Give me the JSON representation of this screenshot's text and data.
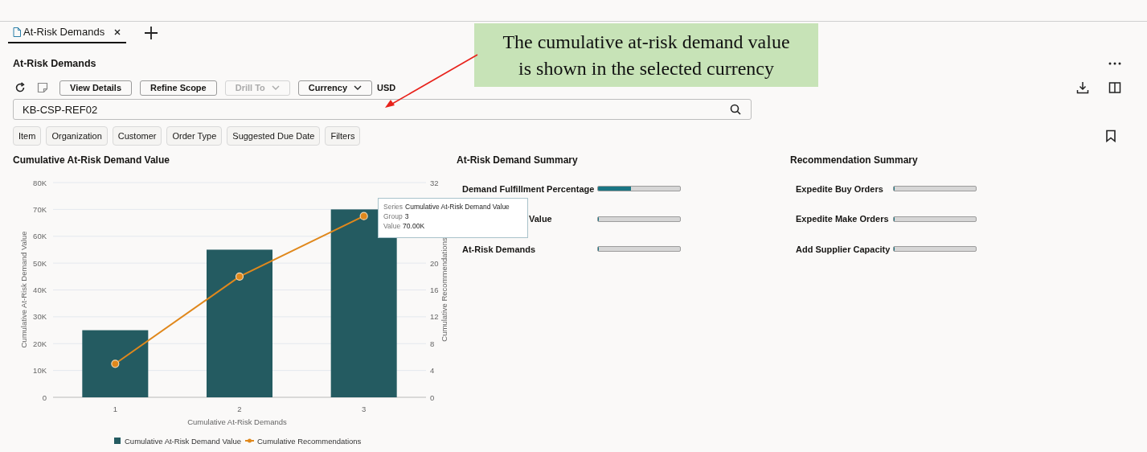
{
  "tab_bar": {
    "tabs": [
      {
        "label": "At-Risk Demands",
        "selected": true
      }
    ]
  },
  "page": {
    "title": "At-Risk Demands"
  },
  "toolbar": {
    "buttons": [
      {
        "label": "View Details",
        "kind": "button",
        "disabled": false
      },
      {
        "label": "Refine Scope",
        "kind": "button",
        "disabled": false
      },
      {
        "label": "Drill To",
        "kind": "menu",
        "disabled": true
      },
      {
        "label": "Currency",
        "kind": "menu",
        "disabled": false
      }
    ],
    "currency": "USD"
  },
  "search": {
    "value": "KB-CSP-REF02"
  },
  "filters": [
    "Item",
    "Organization",
    "Customer",
    "Order Type",
    "Suggested Due Date",
    "Filters"
  ],
  "chart_panel": {
    "title": "Cumulative At-Risk Demand Value",
    "chart_data": {
      "type": "bar",
      "grid": true,
      "xlabel": "Cumulative At-Risk Demands",
      "ylabel": "Cumulative At-Risk Demand Value",
      "y2label": "Cumulative Recommendations",
      "categories": [
        "1",
        "2",
        "3"
      ],
      "series": [
        {
          "name": "Cumulative At-Risk Demand Value",
          "color": "#245b61",
          "values": [
            25000,
            55000,
            70000
          ]
        },
        {
          "name": "Cumulative Recommendations",
          "color": "#e0881c",
          "values": [
            5,
            18,
            27
          ]
        }
      ],
      "ylim": [
        0,
        80000
      ],
      "y2lim": [
        0,
        32
      ],
      "yticks": [
        {
          "value": 0,
          "label": "0"
        },
        {
          "value": 10000,
          "label": "10K"
        },
        {
          "value": 20000,
          "label": "20K"
        },
        {
          "value": 30000,
          "label": "30K"
        },
        {
          "value": 40000,
          "label": "40K"
        },
        {
          "value": 50000,
          "label": "50K"
        },
        {
          "value": 60000,
          "label": "60K"
        },
        {
          "value": 70000,
          "label": "70K"
        },
        {
          "value": 80000,
          "label": "80K"
        }
      ],
      "y2ticks": [
        0,
        4,
        8,
        12,
        16,
        20,
        32
      ]
    },
    "tooltip": {
      "rows": [
        {
          "key": "Series",
          "value": "Cumulative At-Risk Demand Value"
        },
        {
          "key": "Group",
          "value": "3"
        },
        {
          "key": "Value",
          "value": "70.00K"
        }
      ]
    }
  },
  "demand_summary": {
    "title": "At-Risk Demand Summary",
    "rows": [
      {
        "label": "Demand Fulfillment Percentage",
        "kind": "full",
        "level": 0.4
      },
      {
        "label": "Value",
        "kind": "cut",
        "level": 0
      },
      {
        "label": "At-Risk Demands",
        "kind": "full",
        "level": 0
      }
    ]
  },
  "recommendation_summary": {
    "title": "Recommendation Summary",
    "rows": [
      {
        "label": "Expedite Buy Orders",
        "kind": "full",
        "level": 0
      },
      {
        "label": "Expedite Make Orders",
        "kind": "full",
        "level": 0
      },
      {
        "label": "Add Supplier Capacity",
        "kind": "full",
        "level": 0
      }
    ]
  },
  "callout": {
    "text": "The cumulative at-risk demand value\nis shown in the selected currency"
  }
}
